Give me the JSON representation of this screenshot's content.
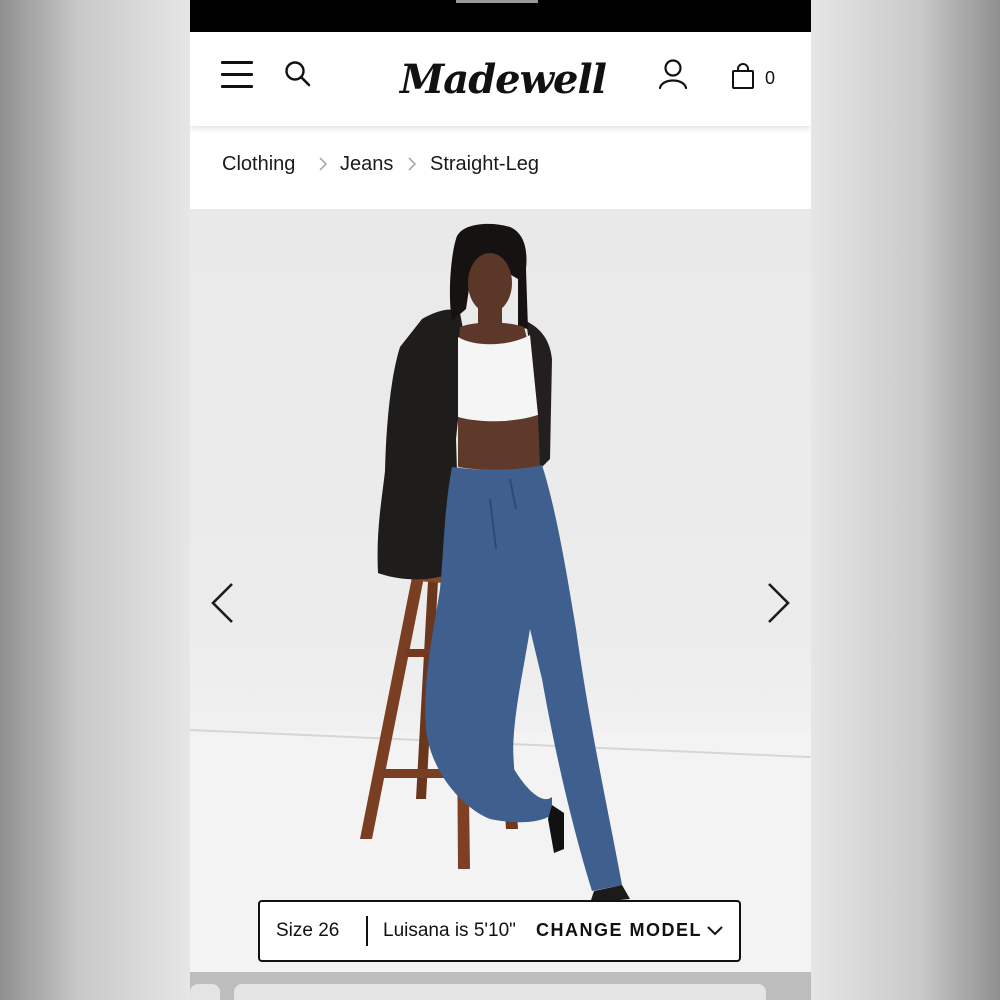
{
  "header": {
    "menu_icon": "hamburger-menu-icon",
    "search_icon": "search-icon",
    "brand": "Madewell",
    "account_icon": "account-icon",
    "bag_icon": "shopping-bag-icon",
    "bag_count": "0"
  },
  "breadcrumb": {
    "items": [
      "Clothing",
      "Jeans",
      "Straight-Leg"
    ],
    "separator_icon": "chevron-right-icon"
  },
  "gallery": {
    "prev_icon": "chevron-left-icon",
    "next_icon": "chevron-right-icon"
  },
  "model_bar": {
    "size": "Size 26",
    "model_info": "Luisana is 5'10\"",
    "change_label": "CHANGE MODEL",
    "chevron_icon": "chevron-down-icon"
  }
}
